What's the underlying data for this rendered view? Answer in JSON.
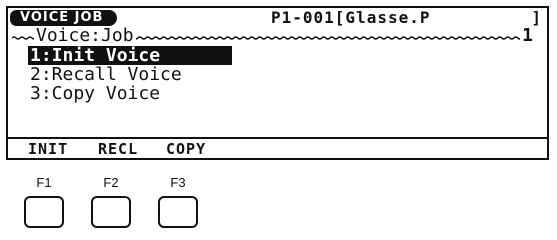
{
  "lcd": {
    "header": {
      "tab_label": "VOICE JOB",
      "patch_text": "P1-001[Glasse.P",
      "patch_end": "]"
    },
    "title": "Voice:Job",
    "page_number": "1",
    "menu": [
      {
        "label": "1:Init Voice",
        "selected": true
      },
      {
        "label": "2:Recall Voice",
        "selected": false
      },
      {
        "label": "3:Copy Voice",
        "selected": false
      }
    ],
    "softkeys": [
      "INIT",
      "RECL",
      "COPY"
    ]
  },
  "function_keys": [
    "F1",
    "F2",
    "F3"
  ]
}
